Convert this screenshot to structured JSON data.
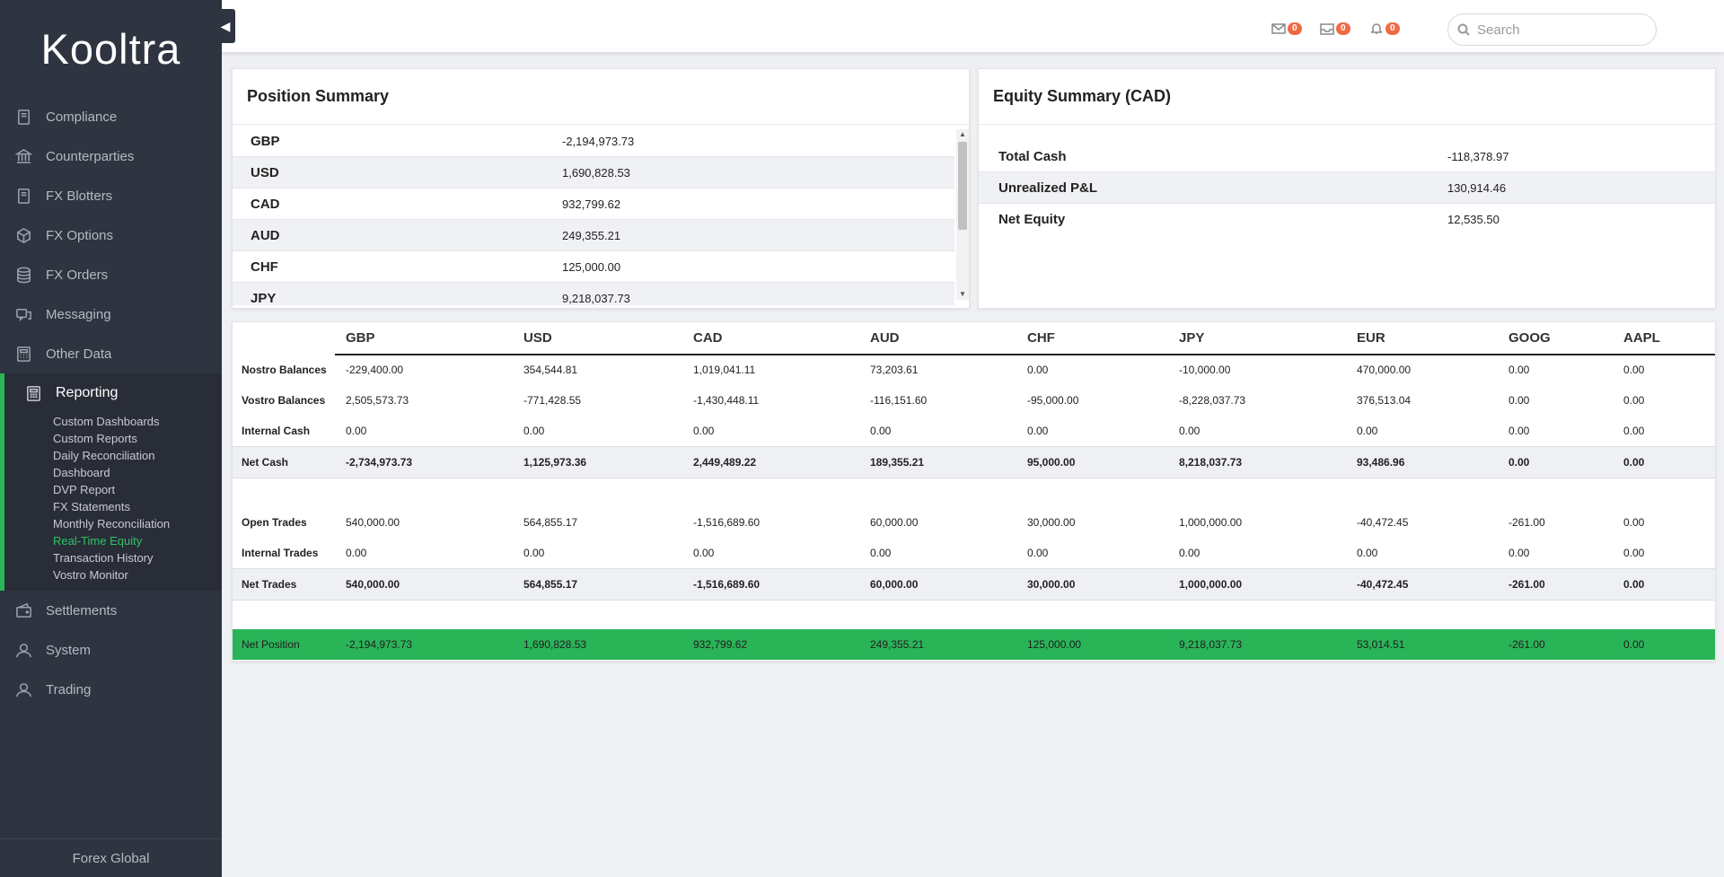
{
  "app": {
    "logo": "Kooltra",
    "footer": "Forex Global"
  },
  "sidebar": {
    "items": [
      {
        "label": "Compliance",
        "icon": "book-icon"
      },
      {
        "label": "Counterparties",
        "icon": "bank-icon"
      },
      {
        "label": "FX Blotters",
        "icon": "book-icon"
      },
      {
        "label": "FX Options",
        "icon": "cube-icon"
      },
      {
        "label": "FX Orders",
        "icon": "database-icon"
      },
      {
        "label": "Messaging",
        "icon": "chat-icon"
      },
      {
        "label": "Other Data",
        "icon": "calculator-icon"
      }
    ],
    "reporting": {
      "label": "Reporting",
      "icon": "calculator-icon",
      "subitems": [
        "Custom Dashboards",
        "Custom Reports",
        "Daily Reconciliation",
        "Dashboard",
        "DVP Report",
        "FX Statements",
        "Monthly Reconciliation",
        "Real-Time Equity",
        "Transaction History",
        "Vostro Monitor"
      ],
      "active_subitem": "Real-Time Equity"
    },
    "items_after": [
      {
        "label": "Settlements",
        "icon": "wallet-icon"
      },
      {
        "label": "System",
        "icon": "user-icon"
      },
      {
        "label": "Trading",
        "icon": "user-icon"
      }
    ]
  },
  "topbar": {
    "mail_count": "0",
    "inbox_count": "0",
    "bell_count": "0",
    "search_placeholder": "Search"
  },
  "position_summary": {
    "title": "Position Summary",
    "rows": [
      {
        "currency": "GBP",
        "amount": "-2,194,973.73"
      },
      {
        "currency": "USD",
        "amount": "1,690,828.53"
      },
      {
        "currency": "CAD",
        "amount": "932,799.62"
      },
      {
        "currency": "AUD",
        "amount": "249,355.21"
      },
      {
        "currency": "CHF",
        "amount": "125,000.00"
      },
      {
        "currency": "JPY",
        "amount": "9,218,037.73"
      }
    ]
  },
  "equity_summary": {
    "title": "Equity Summary (CAD)",
    "rows": [
      {
        "label": "Total Cash",
        "value": "-118,378.97"
      },
      {
        "label": "Unrealized P&L",
        "value": "130,914.46"
      },
      {
        "label": "Net Equity",
        "value": "12,535.50"
      }
    ]
  },
  "balances": {
    "columns": [
      "GBP",
      "USD",
      "CAD",
      "AUD",
      "CHF",
      "JPY",
      "EUR",
      "GOOG",
      "AAPL"
    ],
    "rows": [
      {
        "label": "Nostro Balances",
        "values": [
          "-229,400.00",
          "354,544.81",
          "1,019,041.11",
          "73,203.61",
          "0.00",
          "-10,000.00",
          "470,000.00",
          "0.00",
          "0.00"
        ]
      },
      {
        "label": "Vostro Balances",
        "values": [
          "2,505,573.73",
          "-771,428.55",
          "-1,430,448.11",
          "-116,151.60",
          "-95,000.00",
          "-8,228,037.73",
          "376,513.04",
          "0.00",
          "0.00"
        ]
      },
      {
        "label": "Internal Cash",
        "values": [
          "0.00",
          "0.00",
          "0.00",
          "0.00",
          "0.00",
          "0.00",
          "0.00",
          "0.00",
          "0.00"
        ]
      },
      {
        "label": "Net Cash",
        "values": [
          "-2,734,973.73",
          "1,125,973.36",
          "2,449,489.22",
          "189,355.21",
          "95,000.00",
          "8,218,037.73",
          "93,486.96",
          "0.00",
          "0.00"
        ],
        "kind": "total"
      },
      {
        "label": "Open Trades",
        "values": [
          "540,000.00",
          "564,855.17",
          "-1,516,689.60",
          "60,000.00",
          "30,000.00",
          "1,000,000.00",
          "-40,472.45",
          "-261.00",
          "0.00"
        ]
      },
      {
        "label": "Internal Trades",
        "values": [
          "0.00",
          "0.00",
          "0.00",
          "0.00",
          "0.00",
          "0.00",
          "0.00",
          "0.00",
          "0.00"
        ]
      },
      {
        "label": "Net Trades",
        "values": [
          "540,000.00",
          "564,855.17",
          "-1,516,689.60",
          "60,000.00",
          "30,000.00",
          "1,000,000.00",
          "-40,472.45",
          "-261.00",
          "0.00"
        ],
        "kind": "total"
      },
      {
        "label": "Net Position",
        "values": [
          "-2,194,973.73",
          "1,690,828.53",
          "932,799.62",
          "249,355.21",
          "125,000.00",
          "9,218,037.73",
          "53,014.51",
          "-261.00",
          "0.00"
        ],
        "kind": "netpos"
      }
    ]
  },
  "colors": {
    "accent_green": "#2ab458",
    "sidebar_bg": "#2f3441",
    "badge_orange": "#f06a45"
  }
}
